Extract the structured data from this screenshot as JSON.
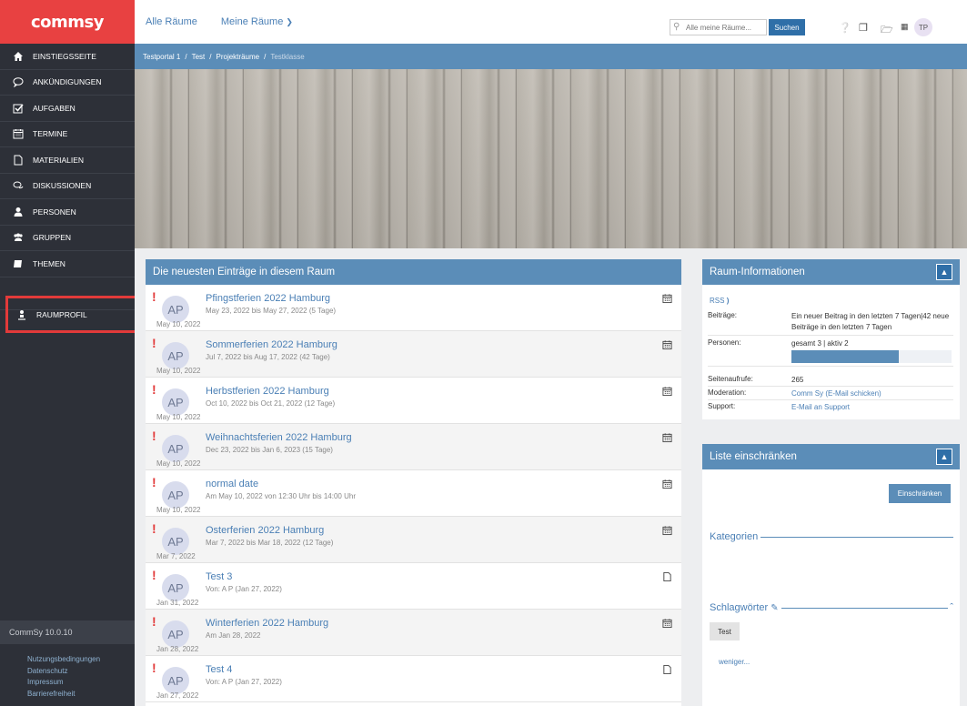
{
  "app": {
    "logo_text": "commsy"
  },
  "sidebar": {
    "items": [
      {
        "label": "Einstiegsseite",
        "icon": "home-icon"
      },
      {
        "label": "Ankündigungen",
        "icon": "speech-bubble-icon"
      },
      {
        "label": "Aufgaben",
        "icon": "checkbox-icon"
      },
      {
        "label": "Termine",
        "icon": "calendar-icon"
      },
      {
        "label": "Materialien",
        "icon": "document-icon"
      },
      {
        "label": "Diskussionen",
        "icon": "discussion-icon"
      },
      {
        "label": "Personen",
        "icon": "person-icon"
      },
      {
        "label": "Gruppen",
        "icon": "group-icon"
      },
      {
        "label": "Themen",
        "icon": "book-icon"
      }
    ],
    "raumprofil": "Raumprofil",
    "version": "CommSy 10.0.10",
    "footer_links": [
      "Nutzungsbedingungen",
      "Datenschutz",
      "Impressum",
      "Barrierefreiheit"
    ]
  },
  "topbar": {
    "nav_all_rooms": "Alle Räume",
    "nav_my_rooms": "Meine Räume",
    "search_placeholder": "Alle meine Räume...",
    "search_button": "Suchen",
    "avatar_initials": "TP"
  },
  "breadcrumb": [
    "Testportal 1",
    "Test",
    "Projekträume",
    "Testklasse"
  ],
  "entries_panel": {
    "title": "Die neuesten Einträge in diesem Raum",
    "entries": [
      {
        "title": "Pfingstferien 2022 Hamburg",
        "meta": "May 23, 2022 bis May 27, 2022 (5 Tage)",
        "date": "May 10, 2022",
        "avatar": "AP",
        "type": "calendar"
      },
      {
        "title": "Sommerferien 2022 Hamburg",
        "meta": "Jul 7, 2022 bis Aug 17, 2022 (42 Tage)",
        "date": "May 10, 2022",
        "avatar": "AP",
        "type": "calendar"
      },
      {
        "title": "Herbstferien 2022 Hamburg",
        "meta": "Oct 10, 2022 bis Oct 21, 2022 (12 Tage)",
        "date": "May 10, 2022",
        "avatar": "AP",
        "type": "calendar"
      },
      {
        "title": "Weihnachtsferien 2022 Hamburg",
        "meta": "Dec 23, 2022 bis Jan 6, 2023 (15 Tage)",
        "date": "May 10, 2022",
        "avatar": "AP",
        "type": "calendar"
      },
      {
        "title": "normal date",
        "meta": "Am May 10, 2022 von 12:30 Uhr bis 14:00 Uhr",
        "date": "May 10, 2022",
        "avatar": "AP",
        "type": "calendar"
      },
      {
        "title": "Osterferien 2022 Hamburg",
        "meta": "Mar 7, 2022 bis Mar 18, 2022 (12 Tage)",
        "date": "Mar 7, 2022",
        "avatar": "AP",
        "type": "calendar"
      },
      {
        "title": "Test 3",
        "meta": "Von: A P (Jan 27, 2022)",
        "date": "Jan 31, 2022",
        "avatar": "AP",
        "type": "document"
      },
      {
        "title": "Winterferien 2022 Hamburg",
        "meta": "Am Jan 28, 2022",
        "date": "Jan 28, 2022",
        "avatar": "AP",
        "type": "calendar"
      },
      {
        "title": "Test 4",
        "meta": "Von: A P (Jan 27, 2022)",
        "date": "Jan 27, 2022",
        "avatar": "AP",
        "type": "document"
      }
    ]
  },
  "info_panel": {
    "title": "Raum-Informationen",
    "rss": "RSS",
    "posts_label": "Beiträge:",
    "posts_value": "Ein neuer Beitrag in den letzten 7 Tagen|42 neue Beiträge in den letzten 7 Tagen",
    "persons_label": "Personen:",
    "persons_value": "gesamt 3 | aktiv 2",
    "persons_active_fraction": 0.67,
    "views_label": "Seitenaufrufe:",
    "views_value": "265",
    "moderation_label": "Moderation:",
    "moderation_name": "Comm Sy",
    "moderation_mail": "E-Mail schicken",
    "support_label": "Support:",
    "support_value": "E-Mail an Support"
  },
  "filter_panel": {
    "title": "Liste einschränken",
    "restrict_button": "Einschränken",
    "categories_label": "Kategorien",
    "tags_label": "Schlagwörter",
    "tags": [
      "Test"
    ],
    "less_link": "weniger..."
  }
}
